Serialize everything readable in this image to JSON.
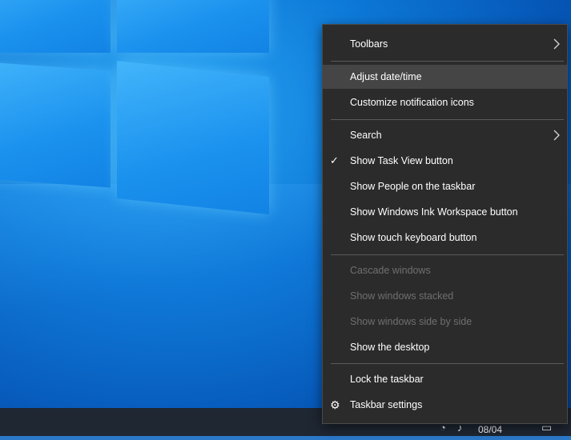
{
  "menu": {
    "items": {
      "toolbars": {
        "label": "Toolbars"
      },
      "adjust_datetime": {
        "label": "Adjust date/time"
      },
      "customize_notification_icons": {
        "label": "Customize notification icons"
      },
      "search": {
        "label": "Search"
      },
      "show_task_view": {
        "label": "Show Task View button",
        "checked": true
      },
      "show_people": {
        "label": "Show People on the taskbar"
      },
      "show_ink_workspace": {
        "label": "Show Windows Ink Workspace button"
      },
      "show_touch_keyboard": {
        "label": "Show touch keyboard button"
      },
      "cascade_windows": {
        "label": "Cascade windows",
        "disabled": true
      },
      "show_windows_stacked": {
        "label": "Show windows stacked",
        "disabled": true
      },
      "show_windows_side_by_side": {
        "label": "Show windows side by side",
        "disabled": true
      },
      "show_desktop": {
        "label": "Show the desktop"
      },
      "lock_taskbar": {
        "label": "Lock the taskbar"
      },
      "taskbar_settings": {
        "label": "Taskbar settings",
        "icon": "gear-icon"
      }
    },
    "hovered": "adjust_datetime"
  },
  "taskbar": {
    "date": "08/04"
  },
  "colors": {
    "menu_background": "#2b2b2b",
    "menu_hover": "#454545",
    "disabled_text": "#6f6f6f",
    "taskbar": "#1f2733"
  }
}
